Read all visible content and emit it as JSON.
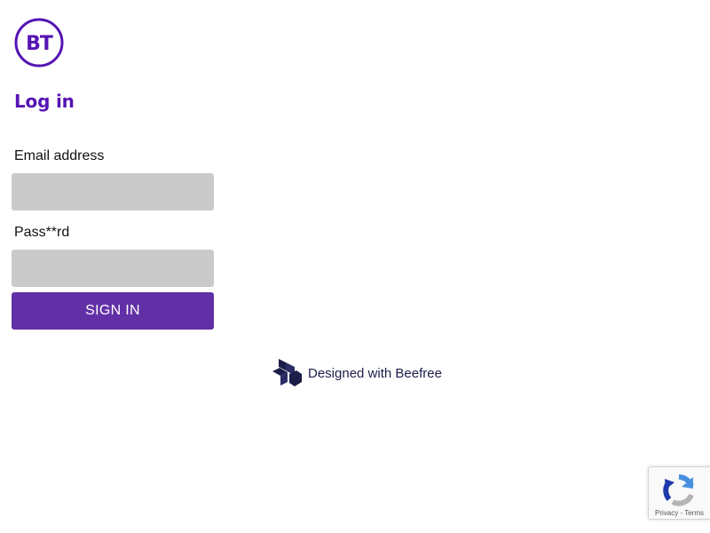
{
  "brand": {
    "logo_text": "BT",
    "color": "#5514b4"
  },
  "form": {
    "heading": "Log in",
    "email_label": "Email address",
    "email_value": "",
    "password_label": "Pass**rd",
    "password_value": "",
    "submit_label": "SIGN IN",
    "submit_color": "#6230a6",
    "input_background": "#cacaca"
  },
  "footer": {
    "credit_text": "Designed with Beefree",
    "credit_icon": "beefree-logo-icon"
  },
  "recaptcha": {
    "icon": "recaptcha-icon",
    "privacy_label": "Privacy",
    "separator": " - ",
    "terms_label": "Terms"
  }
}
